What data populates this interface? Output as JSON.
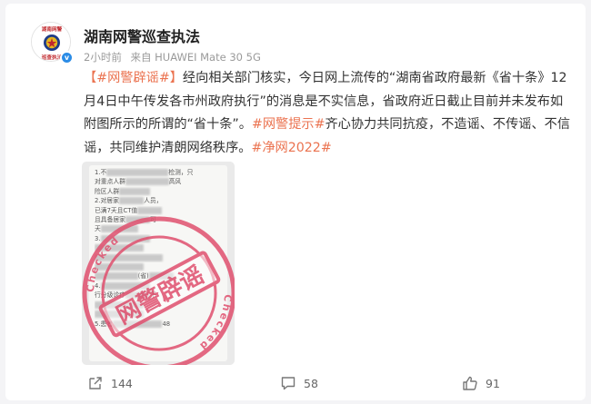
{
  "post": {
    "account_name": "湖南网警巡查执法",
    "avatar_text_top": "湖南网警",
    "avatar_text_bottom": "巡查执法",
    "time": "2小时前",
    "source": "来自 HUAWEI Mate 30 5G",
    "body": {
      "tag_rumor": "【#网警辟谣#】",
      "text1": "经向相关部门核实，今日网上流传的“湖南省政府最新《省十条》12月4日中午传发各市州政府执行”的消息是不实信息，省政府近日截止目前并未发布如附图所示的所谓的“省十条”。",
      "tag_tip": "#网警提示#",
      "text2": "齐心协力共同抗疫，不造谣、不传谣、不信谣，共同维护清朗网络秩序。",
      "tag_net": "#净网2022#"
    }
  },
  "image": {
    "stamp_main": "网警辟谣",
    "stamp_ring": "Checked",
    "doc_lines": [
      "1.不__________检测，只",
      "对重点人群_______高风",
      "险区人群_____",
      "2.对居家____人员，",
      "已满7天且CT值____",
      "且具备居家____可",
      "天______",
      "3.________",
      "________",
      "___________",
      "________",
      "_______(省)____",
      "4.________",
      "行分级诊疗____不",
      "________",
      "________",
      "5.患者________48"
    ]
  },
  "actions": {
    "share_count": "144",
    "comment_count": "58",
    "like_count": "91"
  },
  "colors": {
    "highlight": "#eb7350",
    "stamp": "#e0506e",
    "verified": "#2b8ce6"
  },
  "icons": {
    "share": "share-icon",
    "comment": "comment-icon",
    "like": "thumbs-up-icon"
  }
}
